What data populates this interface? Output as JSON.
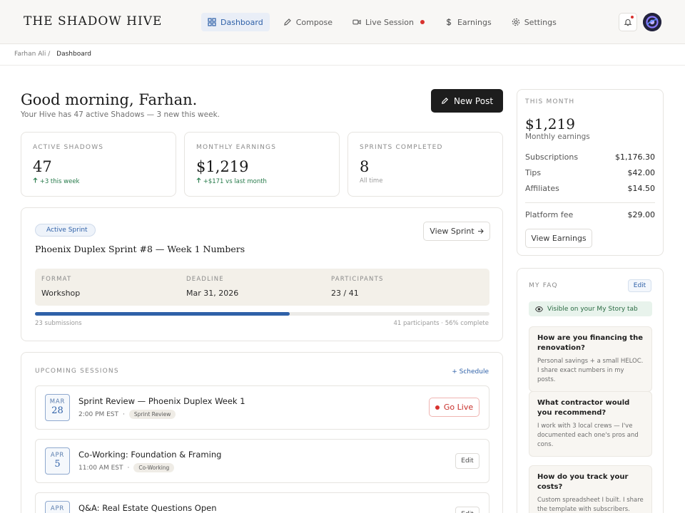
{
  "brand": {
    "logo_text": "THE SHADOW HIVE"
  },
  "nav": {
    "items": [
      {
        "label": "Dashboard",
        "icon": "grid-icon",
        "active": true
      },
      {
        "label": "Compose",
        "icon": "pen-icon"
      },
      {
        "label": "Live Session",
        "icon": "video-icon"
      },
      {
        "label": "Earnings",
        "icon": "dollar-icon"
      },
      {
        "label": "Settings",
        "icon": "gear-icon"
      }
    ]
  },
  "breadcrumb": {
    "root": "Farhan Ali",
    "separator": "/",
    "current": "Dashboard"
  },
  "greeting": {
    "title": "Good morning, Farhan.",
    "subtitle": "Your Hive has 47 active Shadows — 3 new this week."
  },
  "new_post": {
    "label": "New Post"
  },
  "stats": [
    {
      "label": "ACTIVE SHADOWS",
      "value": "47",
      "delta": "+3 this week"
    },
    {
      "label": "MONTHLY EARNINGS",
      "value": "$1,219",
      "delta": "+$171 vs last month"
    },
    {
      "label": "SPRINTS COMPLETED",
      "value": "8",
      "delta": "All time"
    }
  ],
  "sprint": {
    "badge": "Active Sprint",
    "view_label": "View Sprint",
    "title": "Phoenix Duplex Sprint #8 — Week 1 Numbers",
    "format_label": "FORMAT",
    "format_value": "Workshop",
    "deadline_label": "DEADLINE",
    "deadline_value": "Mar 31, 2026",
    "participants_label": "PARTICIPANTS",
    "participants_value": "23 / 41",
    "progress": 0.56,
    "submissions": "23 submissions",
    "summary": "41 participants · 56% complete"
  },
  "sessions": {
    "label": "UPCOMING SESSIONS",
    "schedule_label": "+ Schedule",
    "items": [
      {
        "month": "MAR",
        "day": "28",
        "title": "Sprint Review — Phoenix Duplex Week 1",
        "time": "2:00 PM EST",
        "tag": "Sprint Review",
        "action": "Go Live"
      },
      {
        "month": "APR",
        "day": "5",
        "title": "Co-Working: Foundation & Framing",
        "time": "11:00 AM EST",
        "tag": "Co-Working",
        "action": "Edit"
      },
      {
        "month": "APR",
        "title": "Q&A: Real Estate Questions Open",
        "action": "Edit"
      }
    ]
  },
  "month": {
    "label": "THIS MONTH",
    "total": "$1,219",
    "total_label": "Monthly earnings",
    "rows": [
      {
        "label": "Subscriptions",
        "value": "$1,176.30"
      },
      {
        "label": "Tips",
        "value": "$42.00"
      },
      {
        "label": "Affiliates",
        "value": "$14.50"
      }
    ],
    "fee_label": "Platform fee",
    "fee_value": "$29.00",
    "view_label": "View Earnings"
  },
  "faq": {
    "label": "MY FAQ",
    "edit_label": "Edit",
    "visible_label": "Visible on your My Story tab",
    "items": [
      {
        "q": "How are you financing the renovation?",
        "a": "Personal savings + a small HELOC. I share exact numbers in my posts."
      },
      {
        "q": "What contractor would you recommend?",
        "a": "I work with 3 local crews — I've documented each one's pros and cons."
      },
      {
        "q": "How do you track your costs?",
        "a": "Custom spreadsheet I built. I share the template with subscribers."
      }
    ]
  },
  "colors": {
    "accent": "#2f61a8",
    "live": "#d8322e",
    "positive": "#267a4a",
    "dark": "#1d1d1d"
  }
}
